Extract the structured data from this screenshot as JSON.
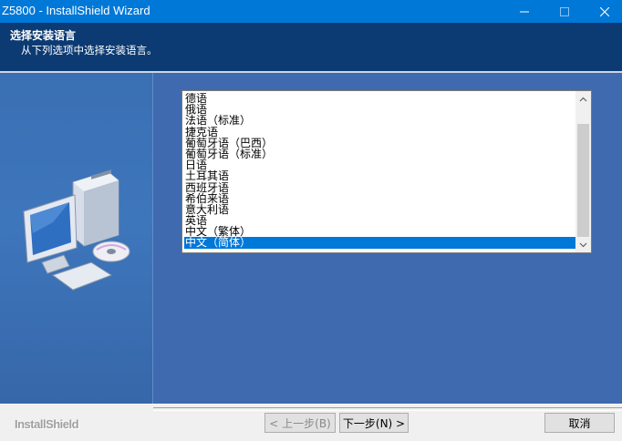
{
  "window": {
    "title": "Z5800 - InstallShield Wizard",
    "minimize_glyph": "—",
    "maximize_glyph": "☐",
    "close_glyph": "✕"
  },
  "header": {
    "title": "选择安装语言",
    "subtitle": "从下列选项中选择安装语言。"
  },
  "languages": {
    "items": [
      "德语",
      "俄语",
      "法语（标准）",
      "捷克语",
      "葡萄牙语（巴西）",
      "葡萄牙语（标准）",
      "日语",
      "土耳其语",
      "西班牙语",
      "希伯来语",
      "意大利语",
      "英语",
      "中文（繁体）",
      "中文（简体）"
    ],
    "selected": "中文（简体）"
  },
  "footer": {
    "brand": "InstallShield",
    "back_label": "< 上一步(B)",
    "next_label": "下一步(N) >",
    "cancel_label": "取消"
  },
  "colors": {
    "titlebar": "#0078d7",
    "header": "#0c3a72",
    "panel": "#3f6aaf",
    "selection": "#0078d7"
  }
}
